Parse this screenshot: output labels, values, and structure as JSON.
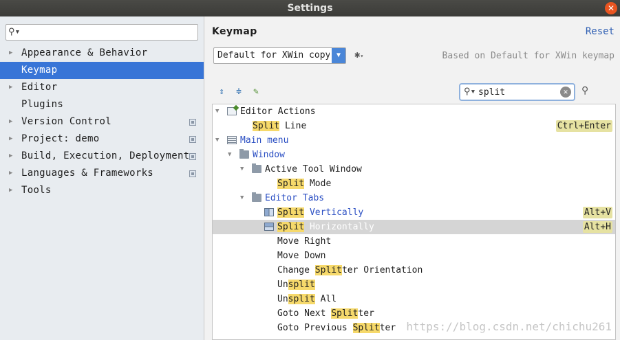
{
  "window": {
    "title": "Settings",
    "close_icon": "close-icon"
  },
  "sidebar": {
    "search": {
      "value": "",
      "placeholder": ""
    },
    "items": [
      {
        "label": "Appearance & Behavior",
        "expandable": true,
        "project_badge": false
      },
      {
        "label": "Keymap",
        "expandable": false,
        "project_badge": false,
        "selected": true
      },
      {
        "label": "Editor",
        "expandable": true,
        "project_badge": false
      },
      {
        "label": "Plugins",
        "expandable": false,
        "project_badge": false
      },
      {
        "label": "Version Control",
        "expandable": true,
        "project_badge": true
      },
      {
        "label": "Project: demo",
        "expandable": true,
        "project_badge": true
      },
      {
        "label": "Build, Execution, Deployment",
        "expandable": true,
        "project_badge": true
      },
      {
        "label": "Languages & Frameworks",
        "expandable": true,
        "project_badge": true
      },
      {
        "label": "Tools",
        "expandable": true,
        "project_badge": false
      }
    ]
  },
  "main": {
    "title": "Keymap",
    "reset_label": "Reset",
    "scheme_value": "Default for XWin copy",
    "based_on": "Based on Default for XWin keymap",
    "search_value": "split",
    "tree": [
      {
        "pre": "",
        "hl": "",
        "post": "Editor Actions",
        "shortcut": ""
      },
      {
        "pre": "",
        "hl": "Split",
        "post": " Line",
        "shortcut": "Ctrl+Enter"
      },
      {
        "pre": "",
        "hl": "",
        "post": "Main menu",
        "shortcut": ""
      },
      {
        "pre": "",
        "hl": "",
        "post": "Window",
        "shortcut": ""
      },
      {
        "pre": "",
        "hl": "",
        "post": "Active Tool Window",
        "shortcut": ""
      },
      {
        "pre": "",
        "hl": "Split",
        "post": " Mode",
        "shortcut": ""
      },
      {
        "pre": "",
        "hl": "",
        "post": "Editor Tabs",
        "shortcut": ""
      },
      {
        "pre": "",
        "hl": "Split",
        "post": " Vertically",
        "shortcut": "Alt+V"
      },
      {
        "pre": "",
        "hl": "Split",
        "post": " Horizontally",
        "shortcut": "Alt+H"
      },
      {
        "pre": "",
        "hl": "",
        "post": "Move Right",
        "shortcut": ""
      },
      {
        "pre": "",
        "hl": "",
        "post": "Move Down",
        "shortcut": ""
      },
      {
        "pre": "Change ",
        "hl": "Split",
        "post": "ter Orientation",
        "shortcut": ""
      },
      {
        "pre": "Un",
        "hl": "split",
        "post": "",
        "shortcut": ""
      },
      {
        "pre": "Un",
        "hl": "split",
        "post": " All",
        "shortcut": ""
      },
      {
        "pre": "Goto Next ",
        "hl": "Split",
        "post": "ter",
        "shortcut": ""
      },
      {
        "pre": "Goto Previous ",
        "hl": "Split",
        "post": "ter",
        "shortcut": ""
      }
    ]
  },
  "watermark": "https://blog.csdn.net/chichu261"
}
